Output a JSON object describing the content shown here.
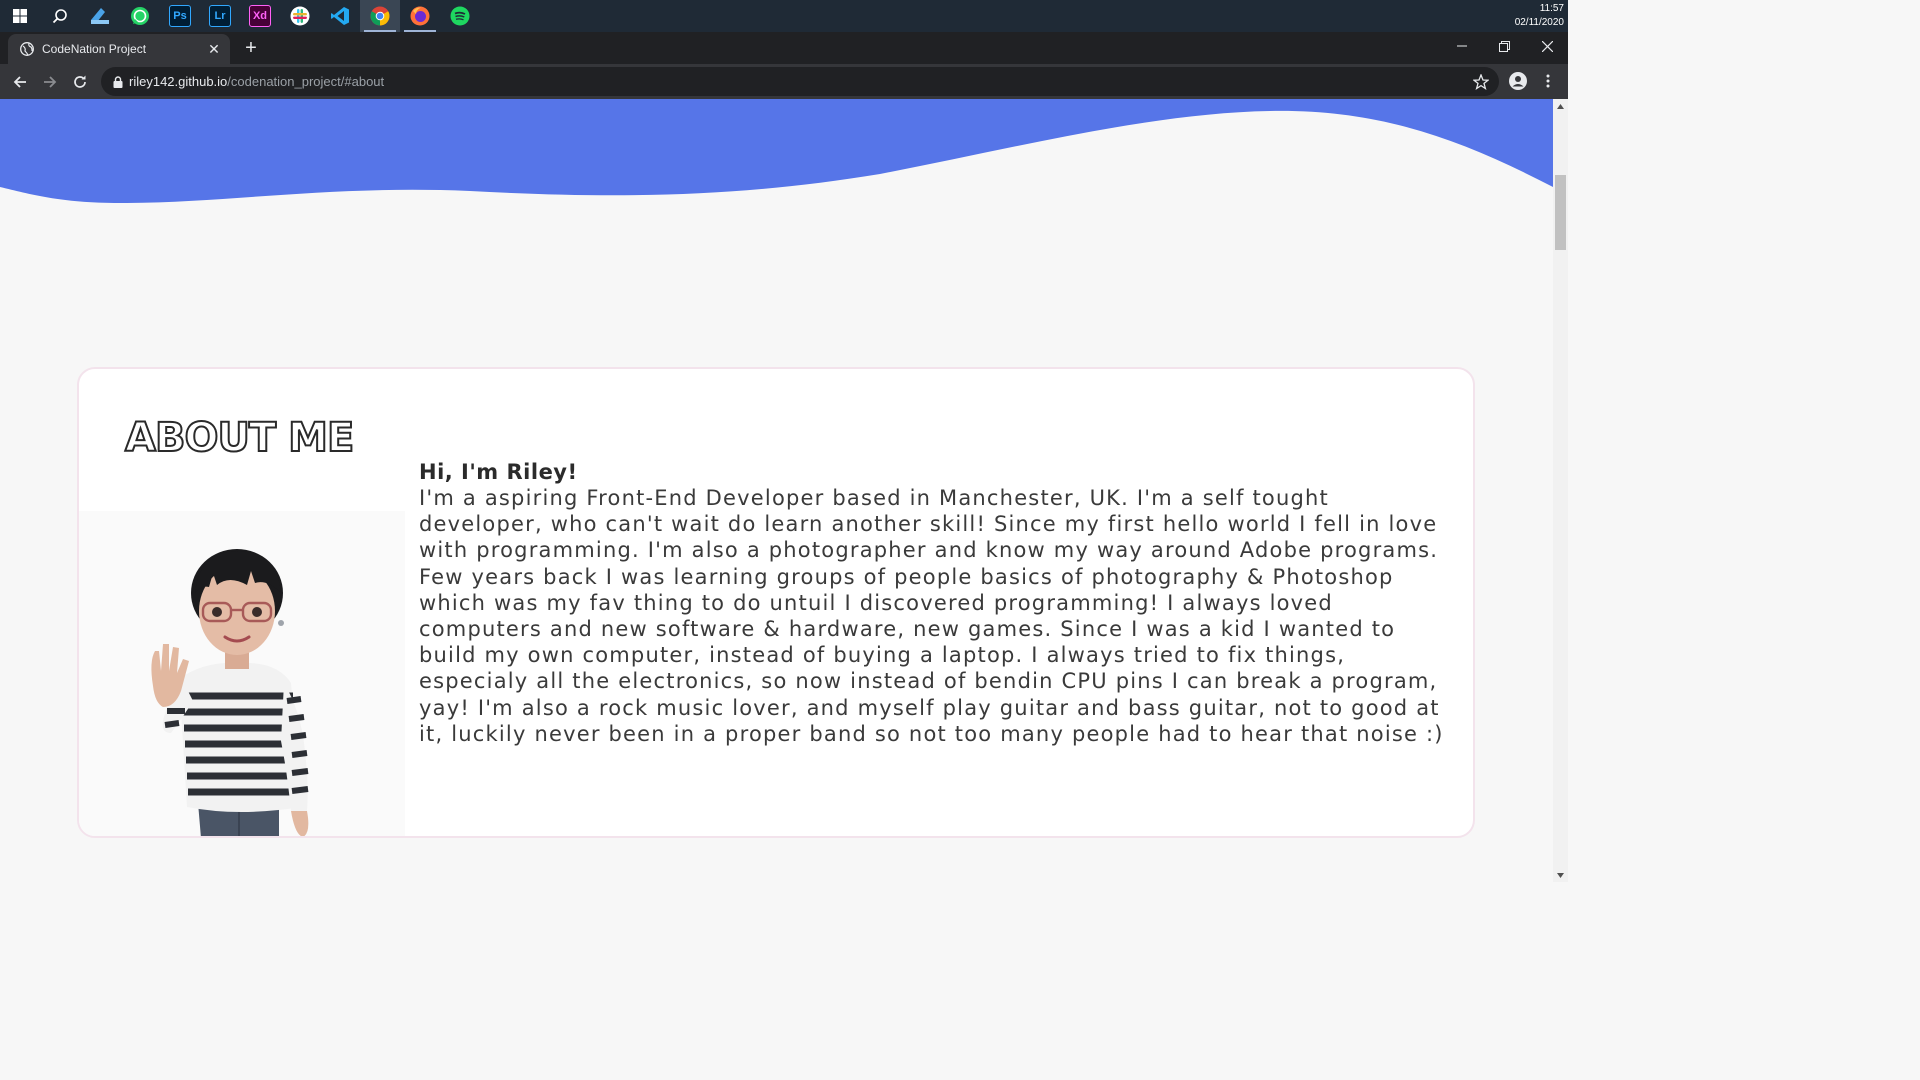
{
  "taskbar": {
    "apps": [
      {
        "icon": "windows-start-icon",
        "label": ""
      },
      {
        "icon": "search-icon",
        "label": ""
      },
      {
        "icon": "file-explorer-icon",
        "label": ""
      },
      {
        "icon": "whatsapp-icon",
        "label": ""
      },
      {
        "icon": "photoshop-icon",
        "label": "Ps"
      },
      {
        "icon": "lightroom-icon",
        "label": "Lr"
      },
      {
        "icon": "adobe-xd-icon",
        "label": "Xd"
      },
      {
        "icon": "slack-icon",
        "label": ""
      },
      {
        "icon": "vscode-icon",
        "label": ""
      },
      {
        "icon": "chrome-icon",
        "label": ""
      },
      {
        "icon": "firefox-icon",
        "label": ""
      },
      {
        "icon": "spotify-icon",
        "label": ""
      }
    ],
    "time": "11:57",
    "date": "02/11/2020"
  },
  "browser": {
    "tab_title": "CodeNation Project",
    "url_host": "riley142.github.io",
    "url_path": "/codenation_project/#about"
  },
  "page": {
    "about_title": "ABOUT ME",
    "greeting": "Hi, I'm Riley!",
    "bio": "I'm a aspiring Front-End Developer based in Manchester, UK. I'm a self tought developer, who can't wait do learn another skill! Since my first hello world I fell in love with programming. I'm also a photographer and know my way around Adobe programs. Few years back I was learning groups of people basics of photography & Photoshop which was my fav thing to do untuil I discovered programming! I always loved computers and new software & hardware, new games. Since I was a kid I wanted to build my own computer, instead of buying a laptop. I always tried to fix things, especialy all the electronics, so now instead of bendin CPU pins I can break a program, yay! I'm also a rock music lover, and myself play guitar and bass guitar, not to good at it, luckily never been in a proper band so not too many people had to hear that noise :)"
  },
  "colors": {
    "wave": "#5675e8",
    "page_bg": "#f7f7f7",
    "card_border": "#f3e3ec"
  }
}
